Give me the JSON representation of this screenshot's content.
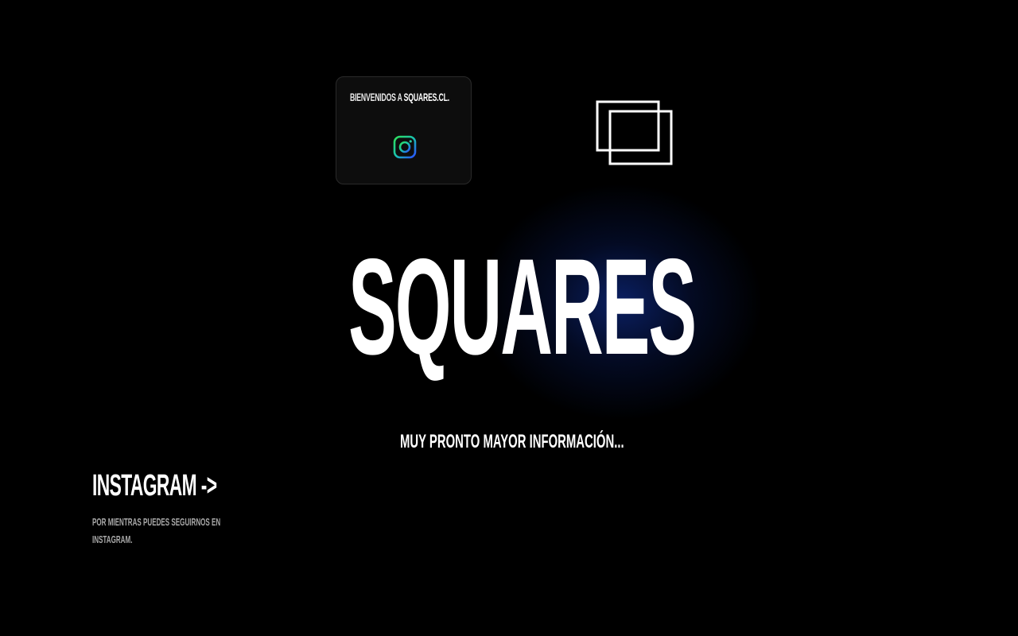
{
  "welcome": {
    "prefix": "BIENVENIDOS A ",
    "brand": "SQUARES.CL."
  },
  "icons": {
    "instagram": "instagram-icon",
    "logo": "squares-logo-icon"
  },
  "hero": {
    "title": "SQUARES"
  },
  "subtitle": "MUY PRONTO MAYOR INFORMACIÓN...",
  "instagram_section": {
    "link_label": "INSTAGRAM ->",
    "description_line1": "POR MIENTRAS PUEDES SEGUIRNOS EN",
    "description_line2": "INSTAGRAM."
  },
  "colors": {
    "background": "#000000",
    "text": "#ffffff",
    "muted_text": "#a8a8a8",
    "card": "#0d0d0d",
    "glow": "#10309a"
  }
}
